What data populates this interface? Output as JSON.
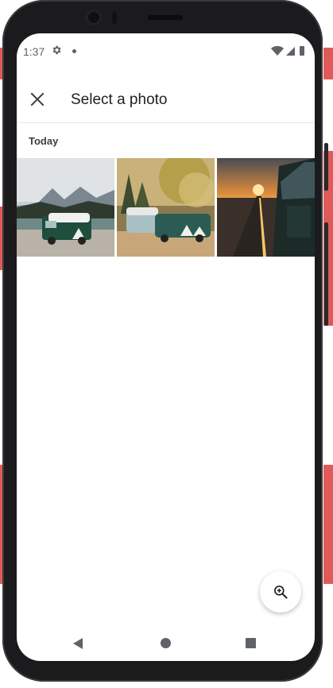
{
  "status_bar": {
    "time": "1:37",
    "icons": [
      "gear-icon",
      "notification-dot-icon",
      "wifi-icon",
      "signal-icon",
      "battery-icon"
    ]
  },
  "app_bar": {
    "title": "Select a photo",
    "close_icon": "close-icon"
  },
  "gallery": {
    "section_label": "Today",
    "photos": [
      {
        "subject": "green and white camper van in front of mountains and lake"
      },
      {
        "subject": "two camper vans parked in a forest at golden hour"
      },
      {
        "subject": "side view of green van on a road at sunset"
      }
    ]
  },
  "fab": {
    "icon": "zoom-in-icon"
  },
  "nav_bar": {
    "icons": [
      "back-icon",
      "home-icon",
      "recents-icon"
    ]
  },
  "colors": {
    "text_primary": "#202124",
    "icon_gray": "#5f6368",
    "divider": "#e6e6e6",
    "bg_strip": "#e05a5a"
  }
}
